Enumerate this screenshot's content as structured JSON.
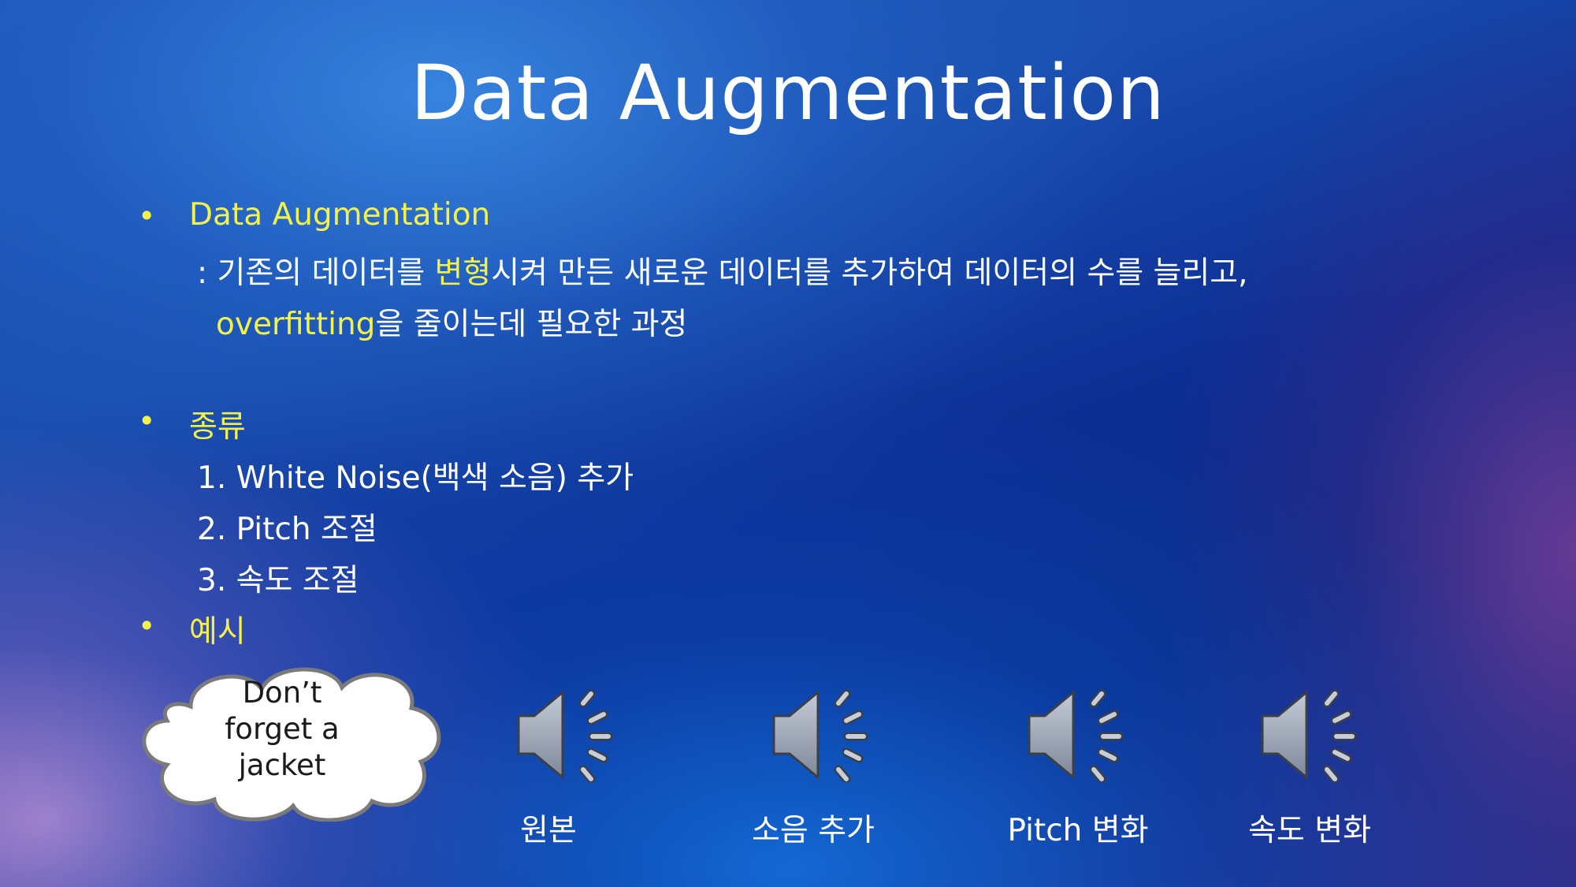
{
  "title": "Data Augmentation",
  "bullets": {
    "symbol": "•",
    "section1": {
      "heading": "Data Augmentation",
      "line1_prefix": ": 기존의 데이터를 ",
      "line1_highlight": "변형",
      "line1_suffix": "시켜 만든 새로운 데이터를 추가하여 데이터의 수를 늘리고,",
      "line2_highlight": "overfitting",
      "line2_suffix": "을 줄이는데 필요한 과정"
    },
    "section2": {
      "heading": "종류",
      "items": [
        "1. White Noise(백색 소음) 추가",
        "2. Pitch 조절",
        "3. 속도 조절"
      ]
    },
    "section3": {
      "heading": "예시"
    }
  },
  "cloud": {
    "lines": [
      "Don’t",
      "forget a",
      "jacket"
    ]
  },
  "audio_examples": [
    {
      "label": "원본",
      "icon": "speaker-icon"
    },
    {
      "label": "소음 추가",
      "icon": "speaker-icon"
    },
    {
      "label": "Pitch 변화",
      "icon": "speaker-icon"
    },
    {
      "label": "속도 변화",
      "icon": "speaker-icon"
    }
  ],
  "colors": {
    "highlight": "#f2f24a",
    "text": "#ffffff",
    "background_primary": "#1a4fb0"
  }
}
